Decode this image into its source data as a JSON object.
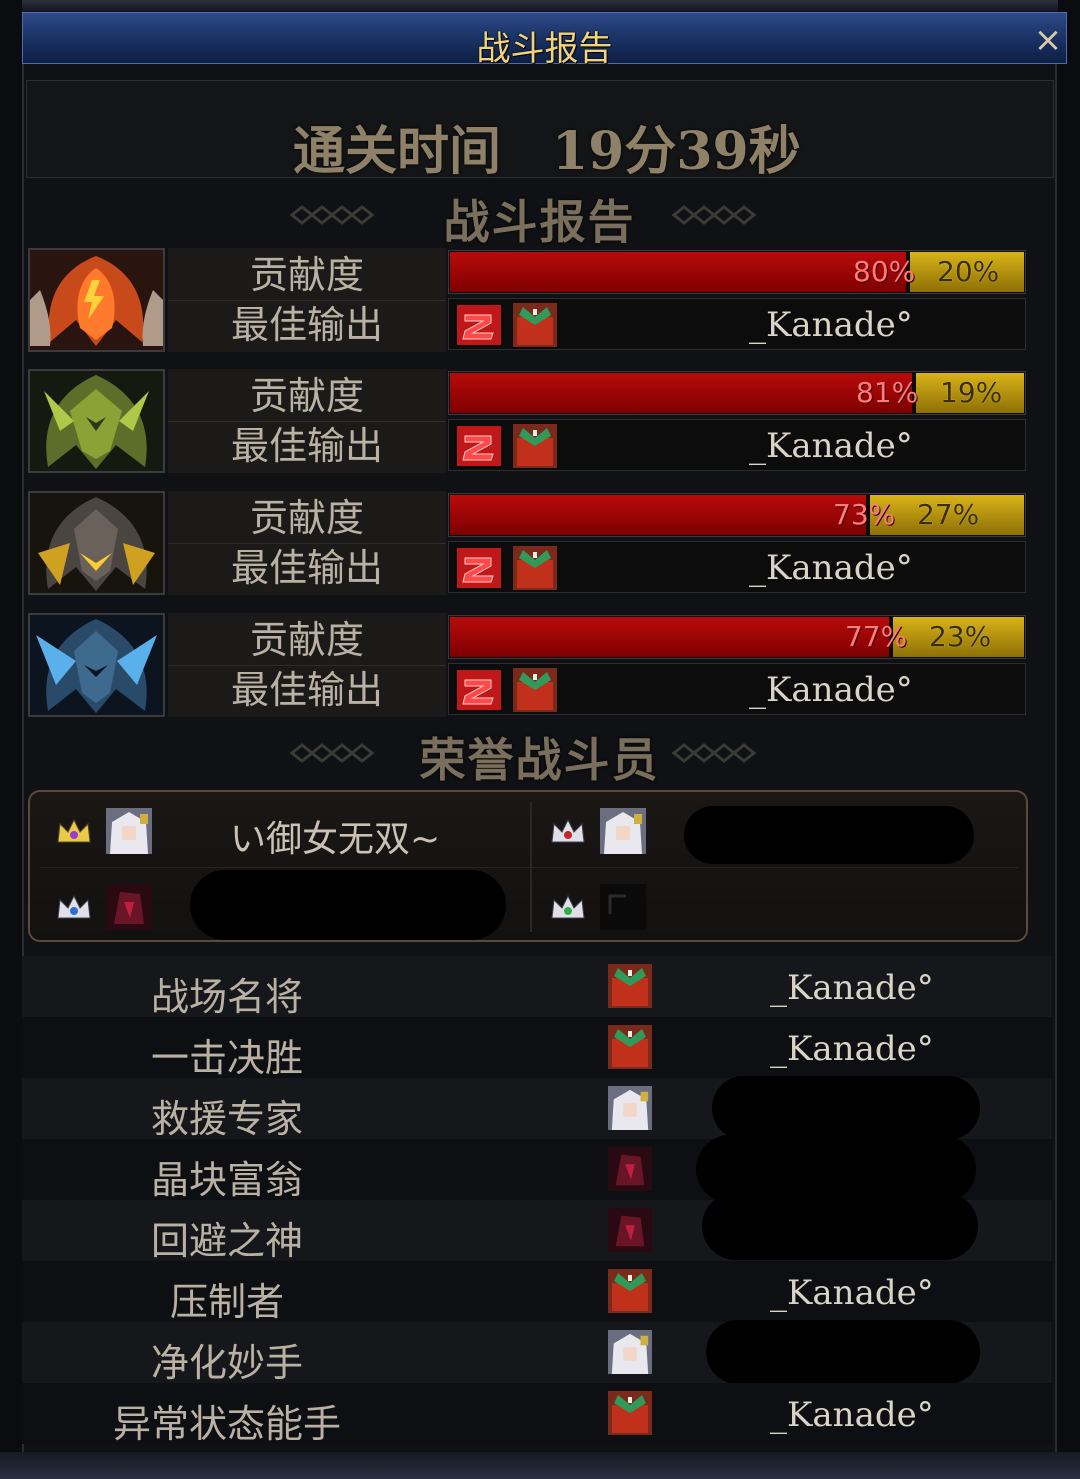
{
  "window": {
    "title": "战斗报告",
    "close_label": "×"
  },
  "clear_time": {
    "label": "通关时间",
    "value": "19分39秒"
  },
  "sections": {
    "battle_report": "战斗报告",
    "honor_members": "荣誉战斗员"
  },
  "bosses": [
    {
      "portrait": "boss-fire-mask-icon",
      "contribution_label": "贡献度",
      "best_output_label": "最佳输出",
      "red_pct": 80,
      "yellow_pct": 20,
      "red_text": "80%",
      "yellow_text": "20%",
      "player": "_Kanade°"
    },
    {
      "portrait": "boss-green-mask-icon",
      "contribution_label": "贡献度",
      "best_output_label": "最佳输出",
      "red_pct": 81,
      "yellow_pct": 19,
      "red_text": "81%",
      "yellow_text": "19%",
      "player": "_Kanade°"
    },
    {
      "portrait": "boss-gold-mask-icon",
      "contribution_label": "贡献度",
      "best_output_label": "最佳输出",
      "red_pct": 73,
      "yellow_pct": 27,
      "red_text": "73%",
      "yellow_text": "27%",
      "player": "_Kanade°"
    },
    {
      "portrait": "boss-blue-mask-icon",
      "contribution_label": "贡献度",
      "best_output_label": "最佳输出",
      "red_pct": 77,
      "yellow_pct": 23,
      "red_text": "77%",
      "yellow_text": "23%",
      "player": "_Kanade°"
    }
  ],
  "honor": [
    {
      "crown_color": "#9b3bd1",
      "avatar": "white-hair-avatar-icon",
      "name": "い御女无双~"
    },
    {
      "crown_color": "#c0262a",
      "avatar": "white-hair-avatar-icon",
      "name": ""
    },
    {
      "crown_color": "#2b6fd6",
      "avatar": "dark-red-avatar-icon",
      "name": ""
    },
    {
      "crown_color": "#2fae4a",
      "avatar": "empty-avatar-icon",
      "name": ""
    }
  ],
  "awards": [
    {
      "title": "战场名将",
      "avatar": "red-avatar-icon",
      "player": "_Kanade°"
    },
    {
      "title": "一击决胜",
      "avatar": "red-avatar-icon",
      "player": "_Kanade°"
    },
    {
      "title": "救援专家",
      "avatar": "white-hair-avatar-icon",
      "player": ""
    },
    {
      "title": "晶块富翁",
      "avatar": "dark-red-avatar-icon",
      "player": ""
    },
    {
      "title": "回避之神",
      "avatar": "dark-red-avatar-icon",
      "player": ""
    },
    {
      "title": "压制者",
      "avatar": "red-avatar-icon",
      "player": "_Kanade°"
    },
    {
      "title": "净化妙手",
      "avatar": "white-hair-avatar-icon",
      "player": ""
    },
    {
      "title": "异常状态能手",
      "avatar": "red-avatar-icon",
      "player": "_Kanade°"
    }
  ]
}
